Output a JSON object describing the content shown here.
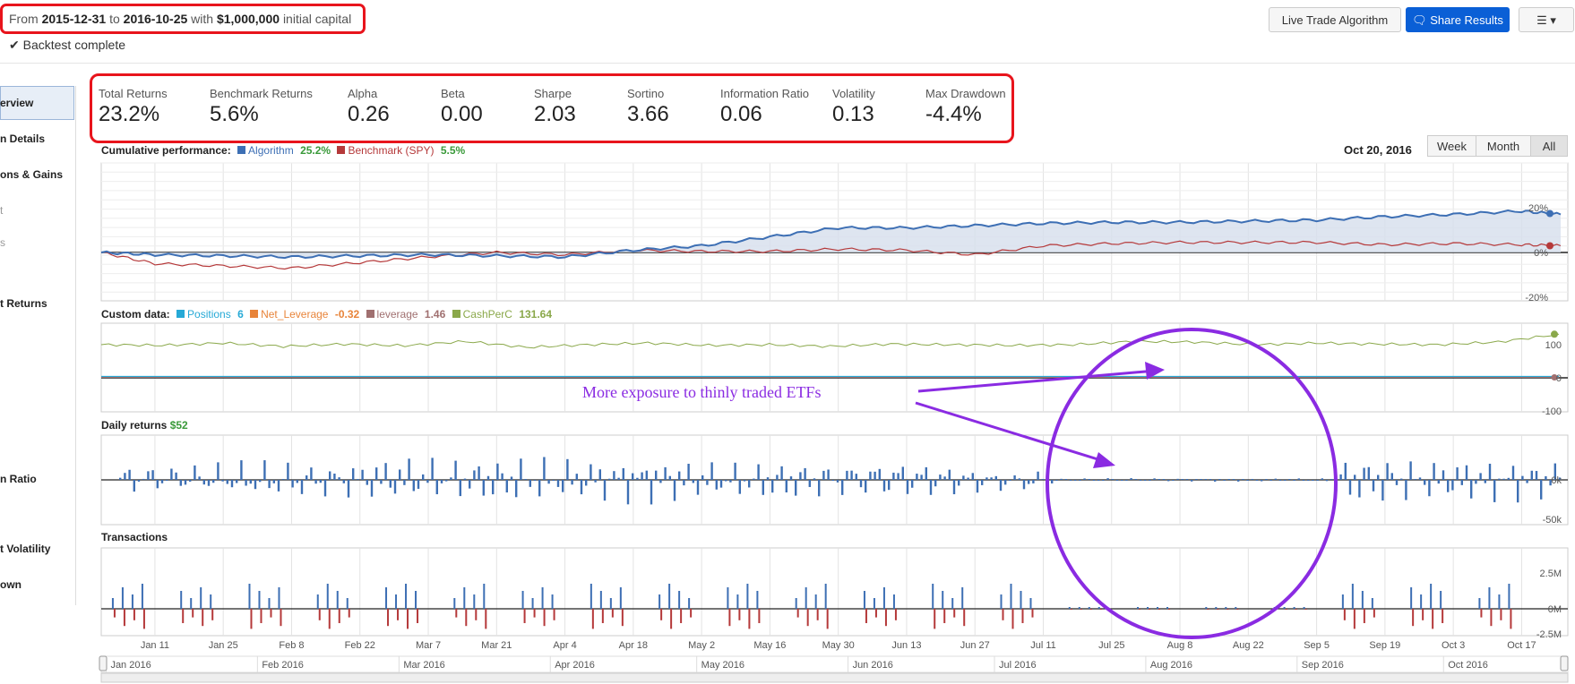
{
  "header": {
    "from_label": "From",
    "start": "2015-12-31",
    "to_label": "to",
    "end": "2016-10-25",
    "with_label": "with",
    "capital": "$1,000,000",
    "capital_suffix": "initial capital",
    "status": "Backtest complete"
  },
  "toolbar": {
    "live_trade_label": "Live Trade Algorithm",
    "share_label": "Share Results",
    "menu_icon": "list-icon"
  },
  "sidebar": {
    "items": [
      {
        "label": "erview"
      },
      {
        "label": "n Details"
      },
      {
        "label": "ons & Gains"
      },
      {
        "label": "t"
      },
      {
        "label": "s"
      },
      {
        "label": "t Returns"
      },
      {
        "label": "n Ratio"
      },
      {
        "label": "t Volatility"
      },
      {
        "label": "own"
      }
    ]
  },
  "stats": [
    {
      "label": "Total Returns",
      "value": "23.2%"
    },
    {
      "label": "Benchmark Returns",
      "value": "5.6%"
    },
    {
      "label": "Alpha",
      "value": "0.26"
    },
    {
      "label": "Beta",
      "value": "0.00"
    },
    {
      "label": "Sharpe",
      "value": "2.03"
    },
    {
      "label": "Sortino",
      "value": "3.66"
    },
    {
      "label": "Information Ratio",
      "value": "0.06"
    },
    {
      "label": "Volatility",
      "value": "0.13"
    },
    {
      "label": "Max Drawdown",
      "value": "-4.4%"
    }
  ],
  "range": {
    "date": "Oct 20, 2016",
    "buttons": [
      "Week",
      "Month",
      "All"
    ],
    "active": "All"
  },
  "colors": {
    "algorithm": "#3d6fb4",
    "benchmark": "#b5393a",
    "positions": "#26a9d6",
    "net_leverage": "#e8843a",
    "leverage": "#a07070",
    "cashperc": "#8aa84a",
    "annotation": "#8a2be2",
    "highlight": "#e8141c"
  },
  "annotation": {
    "text": "More exposure to thinly traded ETFs"
  },
  "chart_data": [
    {
      "type": "line",
      "title": "Cumulative performance:",
      "series": [
        {
          "name": "Algorithm",
          "last": "25.2%",
          "x": [
            "2015-12-31",
            "2016-01-11",
            "2016-01-25",
            "2016-02-08",
            "2016-02-22",
            "2016-03-07",
            "2016-03-21",
            "2016-04-04",
            "2016-04-18",
            "2016-05-02",
            "2016-05-16",
            "2016-05-30",
            "2016-06-13",
            "2016-06-27",
            "2016-07-11",
            "2016-07-25",
            "2016-08-08",
            "2016-08-22",
            "2016-09-05",
            "2016-09-19",
            "2016-10-03",
            "2016-10-17",
            "2016-10-25"
          ],
          "values": [
            0,
            -1,
            -1.5,
            -2,
            -1.5,
            -1,
            -1.5,
            -2,
            1,
            3,
            7,
            11,
            11,
            12,
            13,
            13.5,
            13.5,
            14,
            14.5,
            16,
            17,
            18.5,
            17
          ]
        },
        {
          "name": "Benchmark (SPY)",
          "last": "5.5%",
          "x": [
            "2015-12-31",
            "2016-01-11",
            "2016-01-25",
            "2016-02-08",
            "2016-02-22",
            "2016-03-07",
            "2016-03-21",
            "2016-04-04",
            "2016-04-18",
            "2016-05-02",
            "2016-05-16",
            "2016-05-30",
            "2016-06-13",
            "2016-06-27",
            "2016-07-11",
            "2016-07-25",
            "2016-08-08",
            "2016-08-22",
            "2016-09-05",
            "2016-09-19",
            "2016-10-03",
            "2016-10-17",
            "2016-10-25"
          ],
          "values": [
            0,
            -5,
            -6,
            -7,
            -4.5,
            -2,
            0,
            -1,
            1,
            0.5,
            0.5,
            1.5,
            1,
            -1,
            3,
            4,
            4.5,
            4.5,
            4.5,
            3.5,
            4,
            3.5,
            3
          ]
        }
      ],
      "y_ticks": [
        "20%",
        "0%",
        "-20%"
      ],
      "ylim": [
        -20,
        25
      ]
    },
    {
      "type": "line",
      "title": "Custom data:",
      "series": [
        {
          "name": "Positions",
          "last": "6"
        },
        {
          "name": "Net_Leverage",
          "last": "-0.32"
        },
        {
          "name": "leverage",
          "last": "1.46"
        },
        {
          "name": "CashPerC",
          "last": "131.64",
          "values": [
            100,
            98,
            105,
            95,
            102,
            97,
            110,
            92,
            100,
            105,
            98,
            100,
            95,
            102,
            100,
            98,
            100,
            110,
            108,
            100,
            105,
            102,
            100,
            108,
            131.64
          ]
        }
      ],
      "y_ticks": [
        "100",
        "0",
        "-100"
      ],
      "ylim": [
        -100,
        140
      ]
    },
    {
      "type": "bar",
      "title": "Daily returns",
      "title_value": "$52",
      "y_ticks": [
        "0k",
        "-50k"
      ],
      "ylim": [
        -50000,
        30000
      ]
    },
    {
      "type": "bar",
      "title": "Transactions",
      "y_ticks": [
        "2.5M",
        "0M",
        "-2.5M"
      ],
      "ylim": [
        -2500000,
        2500000
      ]
    }
  ],
  "x_axis": {
    "ticks": [
      "Jan 11",
      "Jan 25",
      "Feb 8",
      "Feb 22",
      "Mar 7",
      "Mar 21",
      "Apr 4",
      "Apr 18",
      "May 2",
      "May 16",
      "May 30",
      "Jun 13",
      "Jun 27",
      "Jul 11",
      "Jul 25",
      "Aug 8",
      "Aug 22",
      "Sep 5",
      "Sep 19",
      "Oct 3",
      "Oct 17"
    ],
    "navigator": [
      "Jan 2016",
      "Feb 2016",
      "Mar 2016",
      "Apr 2016",
      "May 2016",
      "Jun 2016",
      "Jul 2016",
      "Aug 2016",
      "Sep 2016",
      "Oct 2016"
    ]
  }
}
